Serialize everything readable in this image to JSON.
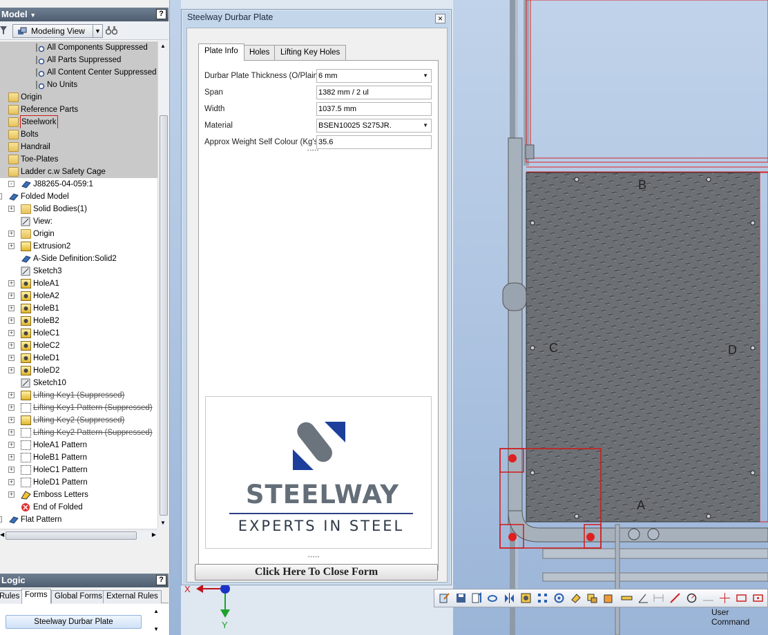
{
  "browser": {
    "title": "Model",
    "view_mode": "Modeling View",
    "tree": [
      {
        "label": "All Components Suppressed",
        "icon": "suppress-icon",
        "shaded": true
      },
      {
        "label": "All Parts Suppressed",
        "icon": "suppress-icon",
        "shaded": true
      },
      {
        "label": "All Content Center Suppressed",
        "icon": "suppress-icon",
        "shaded": true
      },
      {
        "label": "No Units",
        "icon": "suppress-icon",
        "shaded": true
      },
      {
        "label": "Origin",
        "icon": "folder-icon",
        "shaded": true
      },
      {
        "label": "Reference Parts",
        "icon": "folder-icon",
        "shaded": true
      },
      {
        "label": "Steelwork",
        "icon": "folder-icon",
        "shaded": true,
        "highlight": true
      },
      {
        "label": "Bolts",
        "icon": "folder-icon",
        "shaded": true
      },
      {
        "label": "Handrail",
        "icon": "folder-icon",
        "shaded": true
      },
      {
        "label": "Toe-Plates",
        "icon": "folder-icon",
        "shaded": true
      },
      {
        "label": "Ladder c.w Safety Cage",
        "icon": "folder-icon",
        "shaded": true
      },
      {
        "label": "J88265-04-059:1",
        "icon": "part-icon"
      },
      {
        "label": "Folded Model",
        "icon": "folded-model-icon"
      },
      {
        "label": "Solid Bodies(1)",
        "icon": "folder-icon"
      },
      {
        "label": "View:",
        "icon": "view-icon"
      },
      {
        "label": "Origin",
        "icon": "folder-icon"
      },
      {
        "label": "Extrusion2",
        "icon": "extrusion-icon"
      },
      {
        "label": "A-Side Definition:Solid2",
        "icon": "aside-icon"
      },
      {
        "label": "Sketch3",
        "icon": "sketch-icon"
      },
      {
        "label": "HoleA1",
        "icon": "hole-icon"
      },
      {
        "label": "HoleA2",
        "icon": "hole-icon"
      },
      {
        "label": "HoleB1",
        "icon": "hole-icon"
      },
      {
        "label": "HoleB2",
        "icon": "hole-icon"
      },
      {
        "label": "HoleC1",
        "icon": "hole-icon"
      },
      {
        "label": "HoleC2",
        "icon": "hole-icon"
      },
      {
        "label": "HoleD1",
        "icon": "hole-icon"
      },
      {
        "label": "HoleD2",
        "icon": "hole-icon"
      },
      {
        "label": "Sketch10",
        "icon": "sketch-icon"
      },
      {
        "label": "Lifting Key1 (Suppressed)",
        "icon": "extrusion-icon",
        "suppressed": true
      },
      {
        "label": "Lifting Key1 Pattern (Suppressed)",
        "icon": "pattern-icon",
        "suppressed": true
      },
      {
        "label": "Lifting Key2 (Suppressed)",
        "icon": "extrusion-icon",
        "suppressed": true
      },
      {
        "label": "Lifting Key2 Pattern (Suppressed)",
        "icon": "pattern-icon",
        "suppressed": true
      },
      {
        "label": "HoleA1 Pattern",
        "icon": "pattern-icon"
      },
      {
        "label": "HoleB1 Pattern",
        "icon": "pattern-icon"
      },
      {
        "label": "HoleC1 Pattern",
        "icon": "pattern-icon"
      },
      {
        "label": "HoleD1 Pattern",
        "icon": "pattern-icon"
      },
      {
        "label": "Emboss Letters",
        "icon": "emboss-icon"
      },
      {
        "label": "End of Folded",
        "icon": "end-of-part-icon"
      },
      {
        "label": "Flat Pattern",
        "icon": "flat-pattern-icon"
      }
    ]
  },
  "logic": {
    "title": "Logic",
    "tabs": [
      "Rules",
      "Forms",
      "Global Forms",
      "External Rules"
    ],
    "active_tab": "Forms",
    "form_item": "Steelway Durbar Plate"
  },
  "form": {
    "title": "Steelway Durbar Plate",
    "tabs": [
      "Plate Info",
      "Holes",
      "Lifting Key Holes"
    ],
    "active_tab": "Plate Info",
    "fields": [
      {
        "label": "Durbar Plate Thickness (O/Plain)",
        "value": "6 mm",
        "type": "select"
      },
      {
        "label": "Span",
        "value": "1382 mm / 2 ul",
        "type": "text"
      },
      {
        "label": "Width",
        "value": "1037.5 mm",
        "type": "text"
      },
      {
        "label": "Material",
        "value": "BSEN10025 S275JR.",
        "type": "select"
      },
      {
        "label": "Approx Weight Self Colour (Kg's)",
        "value": "35.6",
        "type": "text"
      }
    ],
    "logo": {
      "word": "STEELWAY",
      "tagline": "EXPERTS IN STEEL"
    },
    "close_button": "Click Here To Close Form"
  },
  "viewport": {
    "plate_labels": [
      "B",
      "C",
      "D",
      "A"
    ],
    "axis_labels": [
      "X",
      "Y"
    ],
    "status_text": "User Command"
  },
  "colors": {
    "brand_blue": "#1d3f9b",
    "brand_grey": "#6b747c",
    "selection_red": "#d81818"
  }
}
